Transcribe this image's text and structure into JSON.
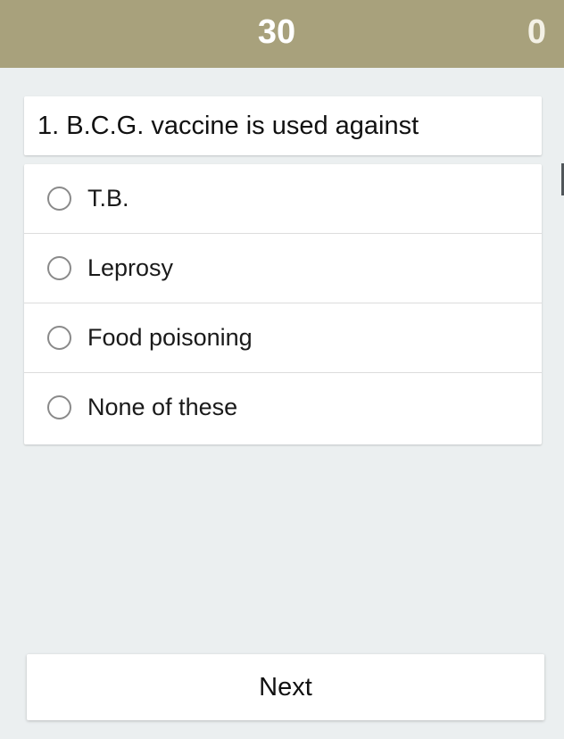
{
  "header": {
    "timer": "30",
    "score": "0"
  },
  "question": {
    "text": "1. B.C.G. vaccine is used against"
  },
  "options": [
    {
      "label": "T.B."
    },
    {
      "label": "Leprosy"
    },
    {
      "label": "Food poisoning"
    },
    {
      "label": "None of these"
    }
  ],
  "actions": {
    "next_label": "Next"
  },
  "colors": {
    "header_bg": "#a8a17c",
    "page_bg": "#ebeff0",
    "card_bg": "#ffffff"
  }
}
